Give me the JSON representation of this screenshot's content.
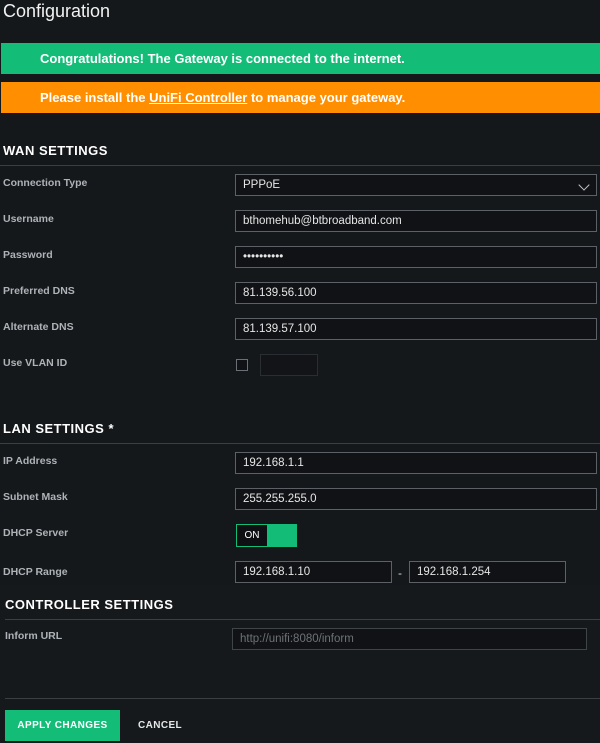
{
  "page": {
    "title": "Configuration"
  },
  "banners": {
    "connected": "Congratulations! The Gateway is connected to the internet.",
    "install_prefix": "Please install the ",
    "install_link": "UniFi Controller",
    "install_suffix": " to manage your gateway."
  },
  "wan": {
    "title": "WAN SETTINGS",
    "connection_type": {
      "label": "Connection Type",
      "value": "PPPoE"
    },
    "username": {
      "label": "Username",
      "value": "bthomehub@btbroadband.com"
    },
    "password": {
      "label": "Password",
      "value": "••••••••••"
    },
    "preferred_dns": {
      "label": "Preferred DNS",
      "value": "81.139.56.100"
    },
    "alternate_dns": {
      "label": "Alternate DNS",
      "value": "81.139.57.100"
    },
    "vlan": {
      "label": "Use VLAN ID",
      "checked": false,
      "value": ""
    }
  },
  "lan": {
    "title": "LAN SETTINGS *",
    "ip_address": {
      "label": "IP Address",
      "value": "192.168.1.1"
    },
    "subnet_mask": {
      "label": "Subnet Mask",
      "value": "255.255.255.0"
    },
    "dhcp_server": {
      "label": "DHCP Server",
      "state": "ON"
    },
    "dhcp_range": {
      "label": "DHCP Range",
      "start": "192.168.1.10",
      "separator": "-",
      "end": "192.168.1.254"
    }
  },
  "controller": {
    "title": "CONTROLLER SETTINGS",
    "inform_url": {
      "label": "Inform URL",
      "placeholder": "http://unifi:8080/inform"
    }
  },
  "actions": {
    "apply": "APPLY CHANGES",
    "cancel": "CANCEL"
  },
  "colors": {
    "accent": "#13bd78",
    "warning": "#ff8f00",
    "background": "#15181b"
  }
}
